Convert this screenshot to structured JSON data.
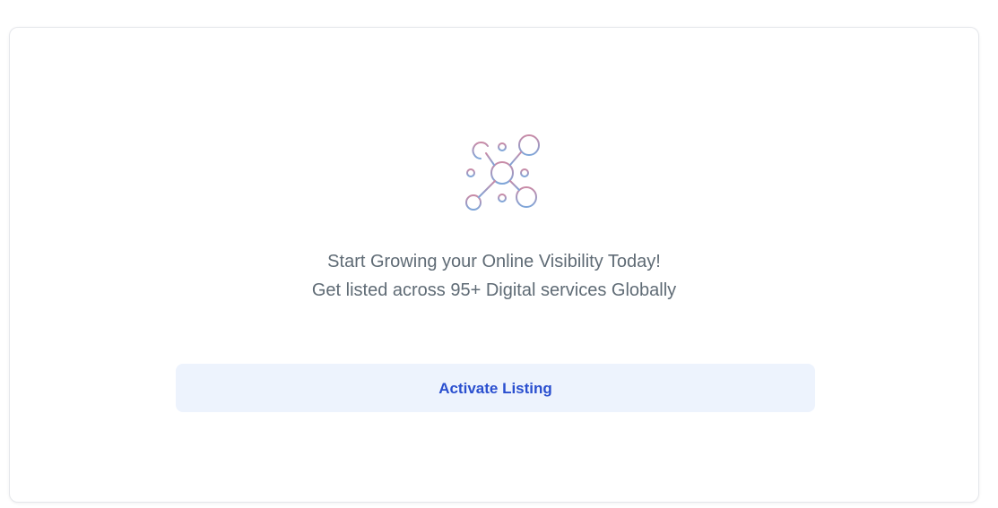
{
  "empty_state": {
    "icon": "network-nodes-icon",
    "headline": "Start Growing your Online Visibility Today!",
    "subheadline": "Get listed across 95+ Digital services Globally",
    "button_label": "Activate Listing"
  },
  "colors": {
    "icon_pink": "#c98aa6",
    "icon_blue": "#7ea6d9",
    "text": "#5f6b75",
    "button_bg": "#edf3fd",
    "button_text": "#2a4fcf"
  }
}
